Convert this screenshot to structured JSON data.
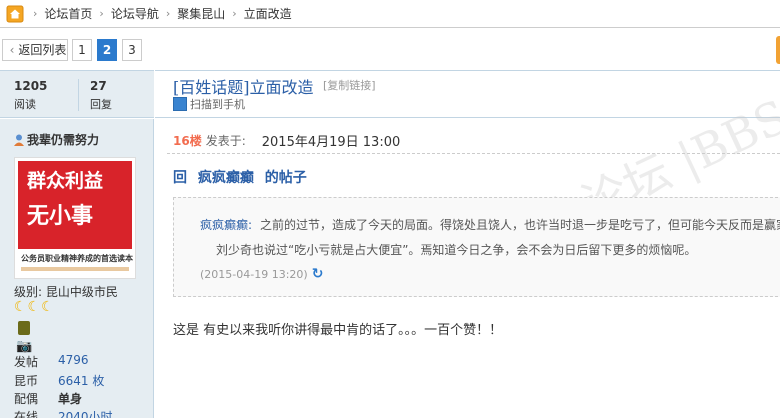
{
  "breadcrumb": {
    "items": [
      "论坛首页",
      "论坛导航",
      "聚集昆山",
      "立面改造"
    ]
  },
  "pager": {
    "back_label": "返回列表",
    "pages": [
      "1",
      "2",
      "3"
    ],
    "current": "2"
  },
  "stats": {
    "views": "1205",
    "views_label": "阅读",
    "replies": "27",
    "replies_label": "回复"
  },
  "thread": {
    "title": "[百姓话题]立面改造",
    "copy_link": "[复制链接]",
    "qr_label": "扫描到手机"
  },
  "user": {
    "name": "我辈仍需努力",
    "avatar_line1": "群众利益",
    "avatar_line2": "无小事",
    "avatar_line3": "公务员职业精神养成的首选读本",
    "level": "级别: 昆山中级市民",
    "moons": "☾☾☾",
    "info": [
      {
        "key": "发帖",
        "value": "4796"
      },
      {
        "key": "昆币",
        "value": "6641 枚"
      },
      {
        "key": "配偶",
        "value": "单身"
      },
      {
        "key": "在线",
        "value": "2040小时"
      }
    ]
  },
  "post": {
    "floor": "16楼",
    "posted_label": "发表于:",
    "posted_time": "2015年4月19日  13:00",
    "reply_prefix": "回",
    "reply_user": "疯疯癫癫",
    "reply_suffix": "的帖子",
    "quote_author": "疯疯癫癫:",
    "quote_line1": "之前的过节，造成了今天的局面。得饶处且饶人，也许当时退一步是吃亏了，但可能今天反而是赢家。",
    "quote_line2": "刘少奇也说过“吃小亏就是占大便宜”。焉知道今日之争，会不会为日后留下更多的烦恼呢。",
    "quote_time": "(2015-04-19 13:20)",
    "body": "这是 有史以来我听你讲得最中肯的话了。。。一百个赞！！",
    "watermark": "昆山论坛 |BBS"
  }
}
